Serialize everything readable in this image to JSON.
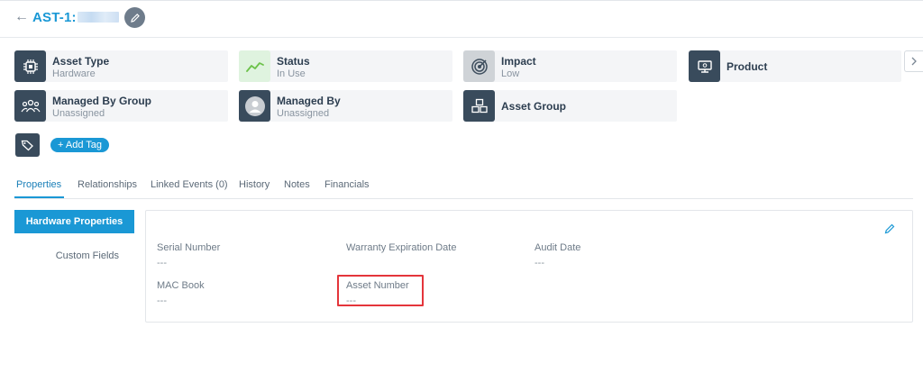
{
  "header": {
    "back_icon": "arrow-left-icon",
    "asset_id": "AST-1:",
    "edit_icon": "pencil-icon"
  },
  "cards": [
    {
      "title": "Asset Type",
      "sub": "Hardware",
      "icon": "chip-icon"
    },
    {
      "title": "Status",
      "sub": "In Use",
      "icon": "trend-line-icon"
    },
    {
      "title": "Impact",
      "sub": "Low",
      "icon": "target-icon"
    },
    {
      "title": "Product",
      "sub": "",
      "icon": "monitor-icon"
    },
    {
      "title": "Managed By Group",
      "sub": "Unassigned",
      "icon": "users-group-icon"
    },
    {
      "title": "Managed By",
      "sub": "Unassigned",
      "icon": "user-avatar-icon"
    },
    {
      "title": "Asset Group",
      "sub": "",
      "icon": "cubes-icon"
    }
  ],
  "tags": {
    "icon": "tag-icon",
    "add_label": "+ Add Tag"
  },
  "tabs": [
    "Properties",
    "Relationships",
    "Linked Events (0)",
    "History",
    "Notes",
    "Financials"
  ],
  "sidebar": {
    "active": "Hardware Properties",
    "other": "Custom Fields"
  },
  "fields": [
    {
      "label": "Serial Number",
      "value": "---"
    },
    {
      "label": "Warranty Expiration Date",
      "value": ""
    },
    {
      "label": "Audit Date",
      "value": "---"
    },
    {
      "label": "MAC Book",
      "value": "---"
    },
    {
      "label": "Asset Number",
      "value": "---"
    }
  ],
  "colors": {
    "accent": "#1a98d5",
    "icon_dark": "#394b5c",
    "highlight": "#e4353b"
  }
}
